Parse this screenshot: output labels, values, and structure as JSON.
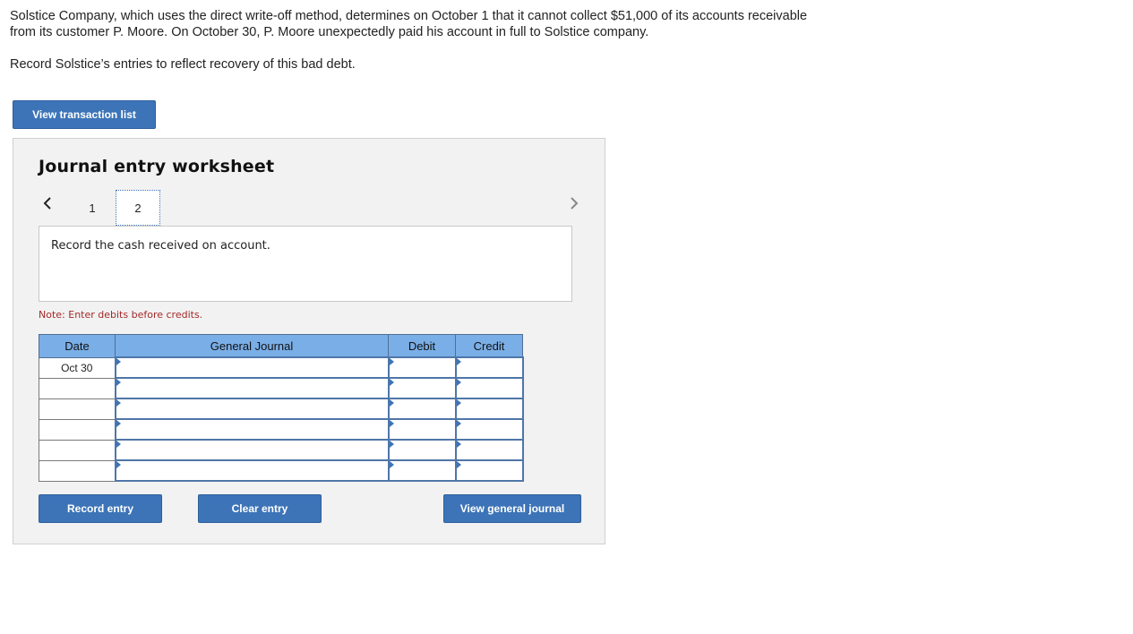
{
  "question": {
    "paragraph1": "Solstice Company, which uses the direct write-off method, determines on October 1 that it cannot collect $51,000 of its accounts receivable from its customer P. Moore. On October 30, P. Moore unexpectedly paid his account in full to Solstice company.",
    "paragraph2": "Record Solstice’s entries to reflect recovery of this bad debt."
  },
  "view_transaction_label": "View transaction list",
  "worksheet": {
    "title": "Journal entry worksheet",
    "pages": [
      "1",
      "2"
    ],
    "active_page": "2",
    "instruction": "Record the cash received on account.",
    "note": "Note: Enter debits before credits.",
    "table": {
      "headers": {
        "date": "Date",
        "general_journal": "General Journal",
        "debit": "Debit",
        "credit": "Credit"
      },
      "rows": [
        {
          "date": "Oct 30",
          "account": "",
          "debit": "",
          "credit": ""
        },
        {
          "date": "",
          "account": "",
          "debit": "",
          "credit": ""
        },
        {
          "date": "",
          "account": "",
          "debit": "",
          "credit": ""
        },
        {
          "date": "",
          "account": "",
          "debit": "",
          "credit": ""
        },
        {
          "date": "",
          "account": "",
          "debit": "",
          "credit": ""
        },
        {
          "date": "",
          "account": "",
          "debit": "",
          "credit": ""
        }
      ]
    },
    "buttons": {
      "record_entry": "Record entry",
      "clear_entry": "Clear entry",
      "view_general_journal": "View general journal"
    }
  },
  "icons": {
    "prev": "chevron-left-icon",
    "next": "chevron-right-icon"
  },
  "colors": {
    "accent": "#3d74b8",
    "header_bg": "#7aaee6",
    "note": "#a52a2a"
  }
}
